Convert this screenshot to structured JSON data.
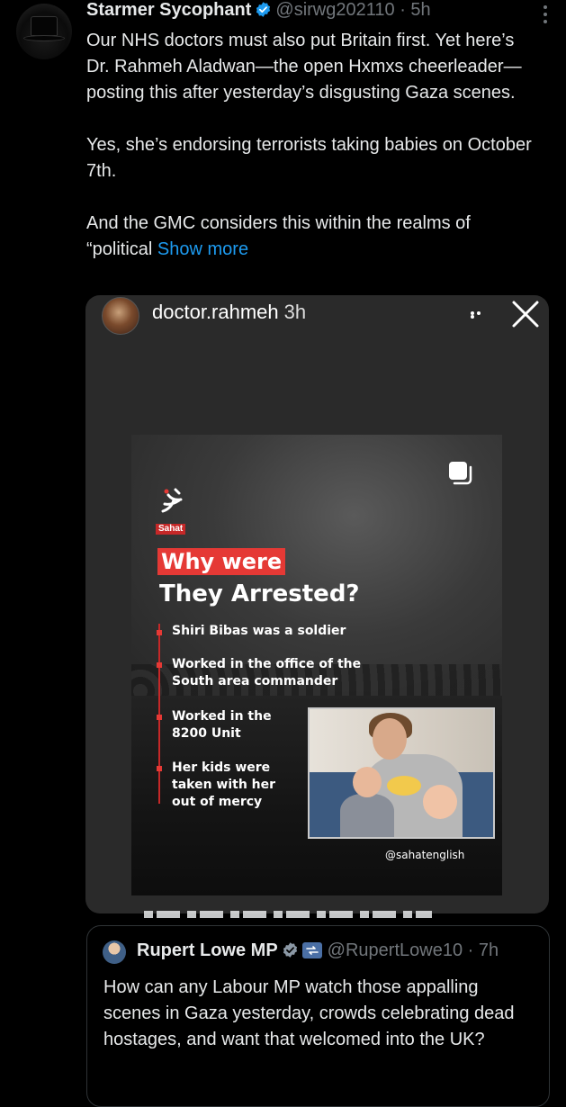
{
  "tweet": {
    "display_name": "Starmer Sycophant",
    "handle": "@sirwg202110",
    "dot": "·",
    "time": "5h",
    "paragraphs": [
      "Our NHS doctors must also put Britain first. Yet here’s Dr. Rahmeh Aladwan—the open Hxmxs cheerleader—posting this after yesterday’s disgusting Gaza scenes.",
      "Yes, she’s endorsing terrorists taking babies on October 7th.",
      "And the GMC considers this within the realms of “political"
    ],
    "show_more_label": "Show more"
  },
  "instagram": {
    "username": "doctor.rahmeh",
    "time": "3h"
  },
  "post_image": {
    "brand": "Sahat",
    "headline_highlight": "Why were",
    "headline_rest": "They Arrested?",
    "points": [
      [
        "Shiri Bibas was a soldier"
      ],
      [
        "Worked in the office of the",
        "South area commander"
      ],
      [
        "Worked in the",
        "8200 Unit"
      ],
      [
        "Her kids were",
        "taken with her",
        "out of mercy"
      ]
    ],
    "watermark": "@sahatenglish",
    "colors": {
      "accent_red": "#e53935"
    }
  },
  "quoted_tweet": {
    "display_name": "Rupert Lowe MP",
    "handle": "@RupertLowe10",
    "dot": "·",
    "time": "7h",
    "text": "How can any Labour MP watch those appalling scenes in Gaza yesterday, crowds celebrating dead hostages, and want that welcomed into the UK?"
  },
  "colors": {
    "link": "#1d9bf0",
    "verified": "#1d9bf0",
    "muted": "#71767b",
    "text": "#e7e9ea"
  }
}
